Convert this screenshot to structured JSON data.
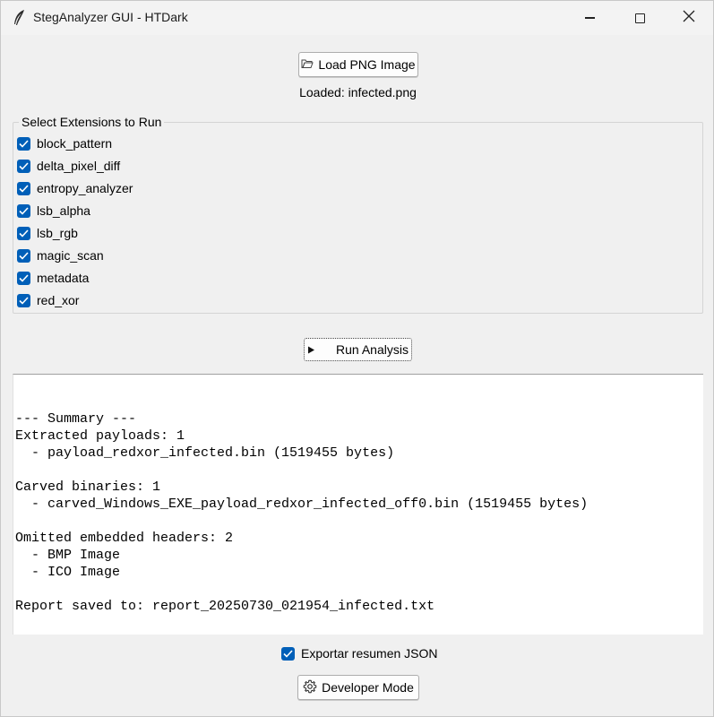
{
  "window": {
    "title": "StegAnalyzer GUI - HTDark",
    "icon": "feather-icon",
    "controls": [
      "minimize-icon",
      "maximize-icon",
      "close-icon"
    ]
  },
  "load_button": {
    "label": "Load PNG Image",
    "icon": "folder-open-icon"
  },
  "loaded_text": "Loaded: infected.png",
  "extensions": {
    "title": "Select Extensions to Run",
    "items": [
      {
        "label": "block_pattern",
        "checked": true
      },
      {
        "label": "delta_pixel_diff",
        "checked": true
      },
      {
        "label": "entropy_analyzer",
        "checked": true
      },
      {
        "label": "lsb_alpha",
        "checked": true
      },
      {
        "label": "lsb_rgb",
        "checked": true
      },
      {
        "label": "magic_scan",
        "checked": true
      },
      {
        "label": "metadata",
        "checked": true
      },
      {
        "label": "red_xor",
        "checked": true
      }
    ]
  },
  "run_button": {
    "label": "Run Analysis",
    "icon": "play-triangle-icon"
  },
  "output": {
    "lines": [
      "--- Summary ---",
      "Extracted payloads: 1",
      "  - payload_redxor_infected.bin (1519455 bytes)",
      "",
      "Carved binaries: 1",
      "  - carved_Windows_EXE_payload_redxor_infected_off0.bin (1519455 bytes)",
      "",
      "Omitted embedded headers: 2",
      "  - BMP Image",
      "  - ICO Image",
      "",
      "Report saved to: report_20250730_021954_infected.txt"
    ]
  },
  "export": {
    "label": "Exportar resumen JSON",
    "checked": true
  },
  "dev_button": {
    "label": "Developer Mode",
    "icon": "gear-icon"
  },
  "colors": {
    "checkbox_accent": "#005fb8",
    "background": "#f0f0f0"
  }
}
